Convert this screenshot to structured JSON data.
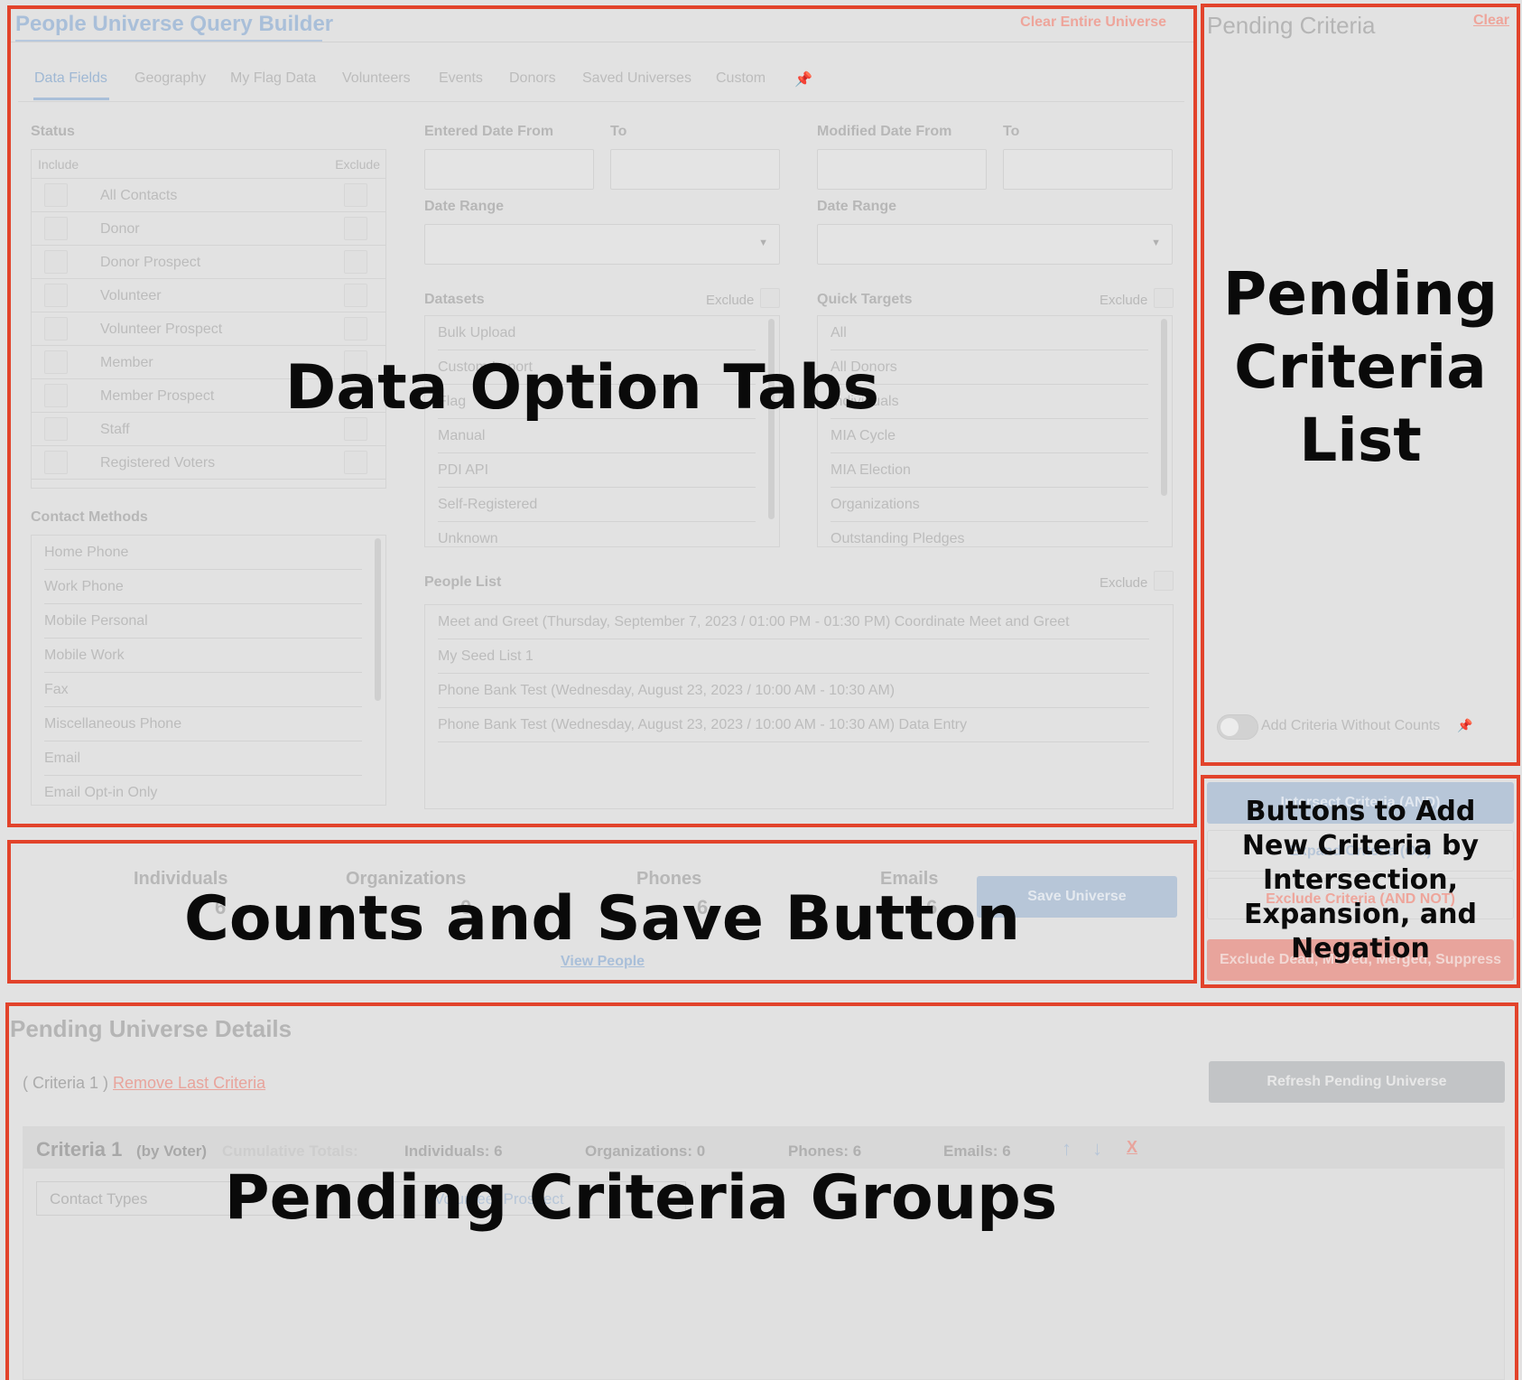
{
  "header": {
    "title": "People Universe Query Builder",
    "clear_universe": "Clear Entire Universe"
  },
  "tabs": [
    "Data Fields",
    "Geography",
    "My Flag Data",
    "Volunteers",
    "Events",
    "Donors",
    "Saved Universes",
    "Custom"
  ],
  "status": {
    "label": "Status",
    "include": "Include",
    "exclude": "Exclude",
    "items": [
      "All Contacts",
      "Donor",
      "Donor Prospect",
      "Volunteer",
      "Volunteer Prospect",
      "Member",
      "Member Prospect",
      "Staff",
      "Registered Voters"
    ]
  },
  "contact_methods": {
    "label": "Contact Methods",
    "items": [
      "Home Phone",
      "Work Phone",
      "Mobile Personal",
      "Mobile Work",
      "Fax",
      "Miscellaneous Phone",
      "Email",
      "Email Opt-in Only"
    ]
  },
  "dates": {
    "entered_from": "Entered Date From",
    "to": "To",
    "modified_from": "Modified Date From",
    "date_range": "Date Range"
  },
  "datasets": {
    "label": "Datasets",
    "exclude": "Exclude",
    "items": [
      "Bulk Upload",
      "Custom Import",
      "Flag",
      "Manual",
      "PDI API",
      "Self-Registered",
      "Unknown"
    ]
  },
  "quick_targets": {
    "label": "Quick Targets",
    "exclude": "Exclude",
    "items": [
      "All",
      "All Donors",
      "Individuals",
      "MIA Cycle",
      "MIA Election",
      "Organizations",
      "Outstanding Pledges"
    ]
  },
  "people_list": {
    "label": "People List",
    "exclude": "Exclude",
    "items": [
      "Meet and Greet (Thursday, September 7, 2023 / 01:00 PM - 01:30 PM) Coordinate Meet and Greet",
      "My Seed List 1",
      "Phone Bank Test (Wednesday, August 23, 2023 / 10:00 AM - 10:30 AM)",
      "Phone Bank Test (Wednesday, August 23, 2023 / 10:00 AM - 10:30 AM) Data Entry"
    ]
  },
  "counts": {
    "individuals_label": "Individuals",
    "individuals": "6",
    "organizations_label": "Organizations",
    "organizations": "0",
    "phones_label": "Phones",
    "phones": "6",
    "emails_label": "Emails",
    "emails": "6",
    "save": "Save Universe",
    "view_people": "View People"
  },
  "pending": {
    "title": "Pending Criteria",
    "clear": "Clear",
    "toggle_label": "Add Criteria Without Counts",
    "btn_and": "Intersect Criteria (AND)",
    "btn_or": "Expand Criteria (OR)",
    "btn_not": "Exclude Criteria (AND NOT)",
    "btn_suppress": "Exclude Dead, Moved, Merged, Suppress"
  },
  "details": {
    "title": "Pending Universe Details",
    "criteria_prefix": "( Criteria 1 )",
    "remove_last": "Remove Last Criteria",
    "refresh": "Refresh Pending Universe",
    "criteria_name": "Criteria 1",
    "by": "(by Voter)",
    "cumulative": "Cumulative Totals:",
    "ind": "Individuals: 6",
    "org": "Organizations: 0",
    "ph": "Phones: 6",
    "em": "Emails: 6",
    "remove_x": "X",
    "field": "Contact Types",
    "value": "Volunteer Prospect"
  },
  "annotations": {
    "tabs": "Data Option Tabs",
    "pending_list": "Pending Criteria List",
    "counts": "Counts and Save Button",
    "buttons": "Buttons to Add New Criteria by Intersection, Expansion, and Negation",
    "groups": "Pending Criteria Groups"
  },
  "colors": {
    "annotation_border": "#e2432b",
    "title_blue": "#a9bfd9",
    "link_red": "#e8a49c",
    "save_button": "#b7c6d8"
  }
}
